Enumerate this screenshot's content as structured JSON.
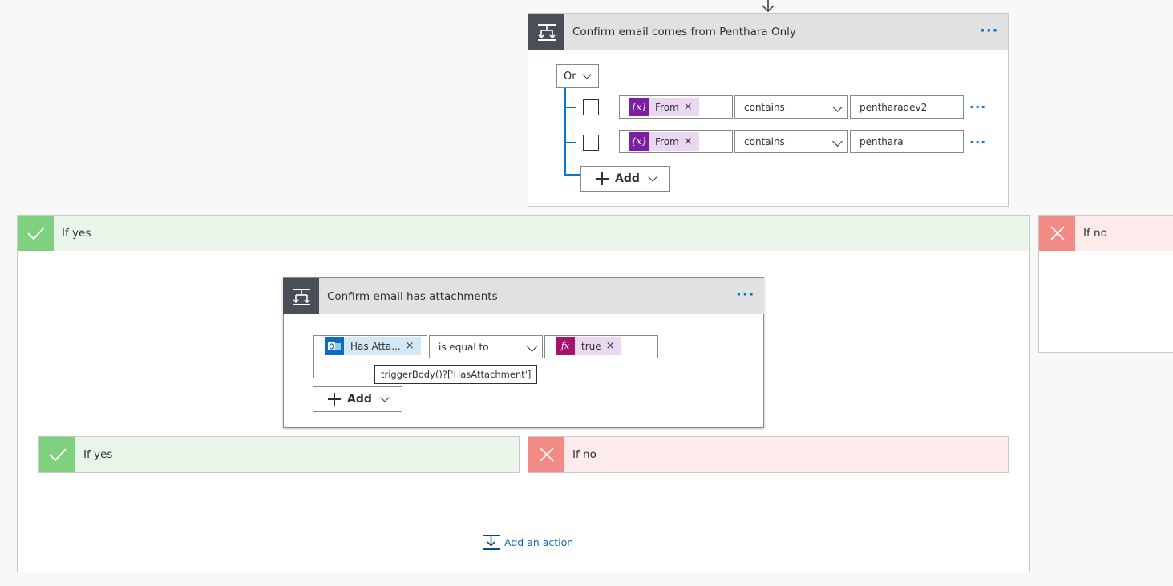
{
  "top_condition": {
    "title": "Confirm email comes from Penthara Only",
    "more_label": "···",
    "group_operator": "Or",
    "rows": [
      {
        "token_icon": "{x}",
        "token_label": "From",
        "token_remove": "×",
        "operator": "contains",
        "value": "pentharadev2",
        "more_label": "···"
      },
      {
        "token_icon": "{x}",
        "token_label": "From",
        "token_remove": "×",
        "operator": "contains",
        "value": "penthara",
        "more_label": "···"
      }
    ],
    "add_label": "Add"
  },
  "yes_branch": {
    "label": "If yes"
  },
  "no_branch": {
    "label": "If no"
  },
  "inner_condition": {
    "title": "Confirm email has attachments",
    "more_label": "···",
    "left_token_label": "Has Atta...",
    "left_token_remove": "×",
    "operator": "is equal to",
    "right_token_icon": "fx",
    "right_token_label": "true",
    "right_token_remove": "×",
    "tooltip": "triggerBody()?['HasAttachment']",
    "add_label": "Add"
  },
  "inner_yes_branch": {
    "label": "If yes"
  },
  "inner_no_branch": {
    "label": "If no"
  },
  "add_action": {
    "label": "Add an action"
  },
  "colors": {
    "yes_bg": "#eaf5ea",
    "yes_icon": "#7fd17f",
    "no_bg": "#fdebeb",
    "no_icon": "#f28a85",
    "link": "#0078d4"
  }
}
